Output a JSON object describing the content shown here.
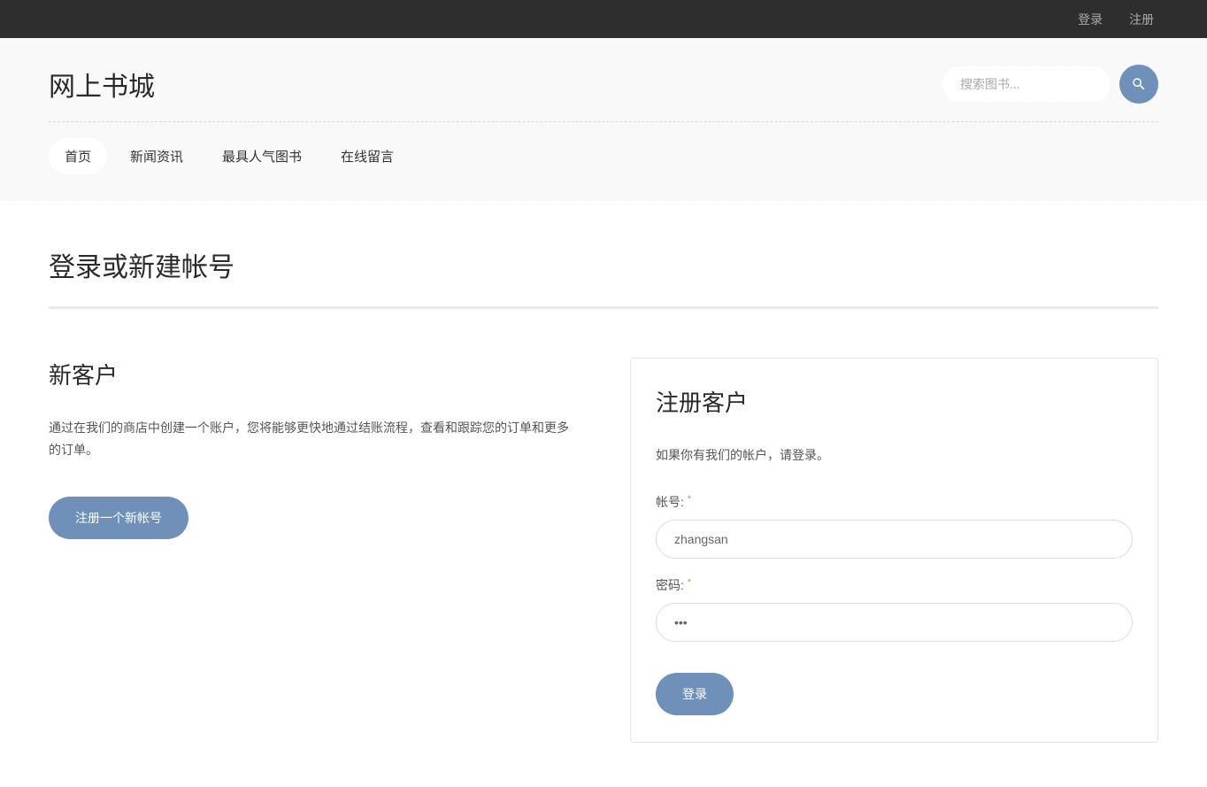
{
  "topbar": {
    "login": "登录",
    "register": "注册"
  },
  "header": {
    "logo": "网上书城",
    "search_placeholder": "搜索图书..."
  },
  "nav": {
    "items": [
      "首页",
      "新闻资讯",
      "最具人气图书",
      "在线留言"
    ],
    "active_index": 0
  },
  "page": {
    "title": "登录或新建帐号"
  },
  "new_customer": {
    "title": "新客户",
    "text": "通过在我们的商店中创建一个账户，您将能够更快地通过结账流程，查看和跟踪您的订单和更多的订单。",
    "button": "注册一个新帐号"
  },
  "login_form": {
    "title": "注册客户",
    "text": "如果你有我们的帐户，请登录。",
    "username_label": "帐号:",
    "username_value": "zhangsan",
    "password_label": "密码:",
    "password_value": "•••",
    "button": "登录",
    "required_mark": "*"
  }
}
